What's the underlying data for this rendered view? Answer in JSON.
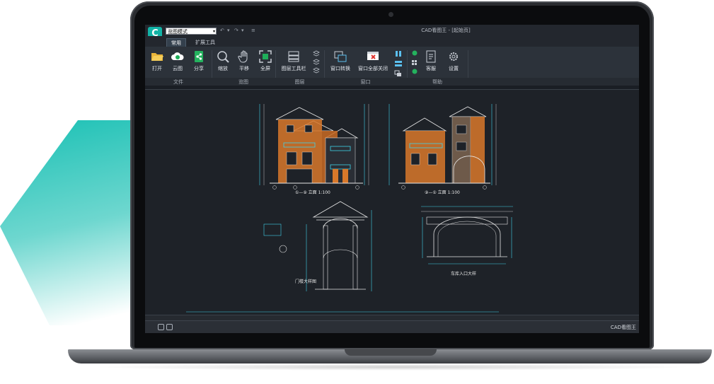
{
  "app": {
    "window_title": "CAD看图王 - [起始页]",
    "view_mode": "览图模式",
    "status_name": "CAD看图王"
  },
  "tabs": [
    {
      "label": "常用",
      "active": true
    },
    {
      "label": "扩展工具",
      "active": false
    }
  ],
  "ribbon": {
    "buttons": {
      "open": "打开",
      "cloud": "云图",
      "share": "分享",
      "zoom": "缩放",
      "pan": "平移",
      "fullscreen": "全屏",
      "layer_toolbar": "图层工具栏",
      "window_switch": "窗口转换",
      "close_all": "窗口全部关闭",
      "service": "客服",
      "settings": "设置"
    },
    "groups": {
      "file": "文件",
      "view": "览图",
      "layer": "图层",
      "window": "窗口",
      "help": "帮助"
    }
  },
  "drawing": {
    "elevation_a": "①—⑨ 立面 1:100",
    "elevation_b": "⑨—① 立面 1:100",
    "gate_a": "门楼大样图",
    "gate_b": "车库入口大样"
  },
  "colors": {
    "accent_teal": "#19c0b4",
    "screen_bg": "#1e2228",
    "ribbon_bg": "#2c323a",
    "facade_orange": "#d9782a",
    "line_cyan": "#3fd2e8",
    "line_white": "#e6e6e6"
  }
}
